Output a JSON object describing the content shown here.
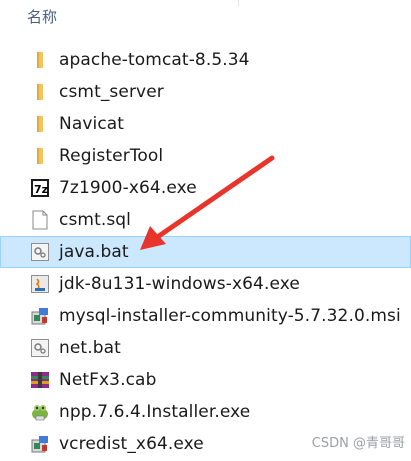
{
  "header": {
    "name_column": "名称"
  },
  "files": [
    {
      "name": "apache-tomcat-8.5.34",
      "icon": "folder-icon",
      "selected": false
    },
    {
      "name": "csmt_server",
      "icon": "folder-icon",
      "selected": false
    },
    {
      "name": "Navicat",
      "icon": "folder-icon",
      "selected": false
    },
    {
      "name": "RegisterTool",
      "icon": "folder-icon",
      "selected": false
    },
    {
      "name": "7z1900-x64.exe",
      "icon": "7zip-icon",
      "selected": false
    },
    {
      "name": "csmt.sql",
      "icon": "document-icon",
      "selected": false
    },
    {
      "name": "java.bat",
      "icon": "batch-file-icon",
      "selected": true
    },
    {
      "name": "jdk-8u131-windows-x64.exe",
      "icon": "java-installer-icon",
      "selected": false
    },
    {
      "name": "mysql-installer-community-5.7.32.0.msi",
      "icon": "msi-installer-icon",
      "selected": false
    },
    {
      "name": "net.bat",
      "icon": "batch-file-icon",
      "selected": false
    },
    {
      "name": "NetFx3.cab",
      "icon": "cab-archive-icon",
      "selected": false
    },
    {
      "name": "npp.7.6.4.Installer.exe",
      "icon": "notepadpp-installer-icon",
      "selected": false
    },
    {
      "name": "vcredist_x64.exe",
      "icon": "msi-installer-icon",
      "selected": false
    }
  ],
  "colors": {
    "selection_bg": "#cce8ff",
    "selection_border": "#99d1ff",
    "folder": "#f2c55c",
    "arrow": "#e8352c"
  },
  "watermark": "CSDN @青哥哥"
}
